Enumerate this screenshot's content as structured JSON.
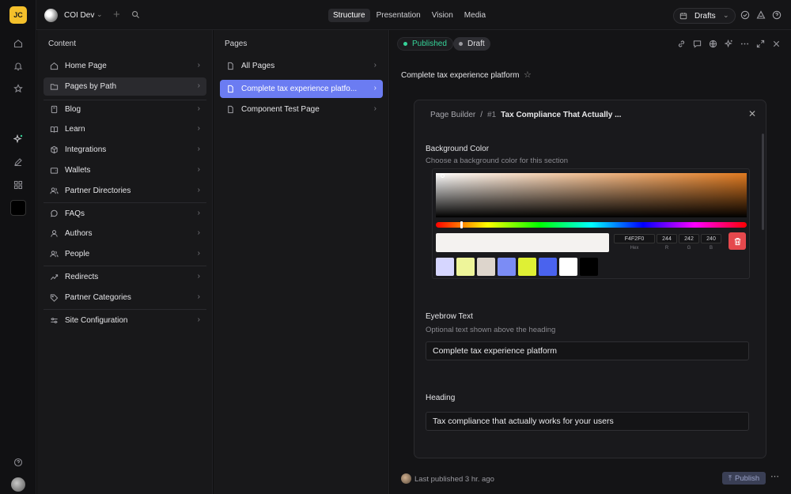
{
  "rail": {
    "avatar_initials": "JC",
    "icons": [
      "home-icon",
      "bell-icon",
      "star-icon",
      "sparkle-icon",
      "pen-icon",
      "grid-icon",
      "swatch-box",
      "help-icon",
      "user-avatar"
    ]
  },
  "topbar": {
    "workspace": "COI Dev",
    "tabs": [
      "Structure",
      "Presentation",
      "Vision",
      "Media"
    ],
    "active_tab": "Structure",
    "drafts_label": "Drafts"
  },
  "content_panel": {
    "title": "Content",
    "items": [
      {
        "label": "Home Page",
        "icon": "home-icon"
      },
      {
        "label": "Pages by Path",
        "icon": "folder-icon"
      },
      {
        "label": "Blog",
        "icon": "book-icon"
      },
      {
        "label": "Learn",
        "icon": "open-book-icon"
      },
      {
        "label": "Integrations",
        "icon": "cube-icon"
      },
      {
        "label": "Wallets",
        "icon": "wallet-icon"
      },
      {
        "label": "Partner Directories",
        "icon": "users-icon"
      },
      {
        "label": "FAQs",
        "icon": "chat-icon"
      },
      {
        "label": "Authors",
        "icon": "user-icon"
      },
      {
        "label": "People",
        "icon": "users-icon"
      },
      {
        "label": "Redirects",
        "icon": "share-icon"
      },
      {
        "label": "Partner Categories",
        "icon": "tag-icon"
      },
      {
        "label": "Site Configuration",
        "icon": "sliders-icon"
      }
    ]
  },
  "pages_panel": {
    "title": "Pages",
    "items": [
      {
        "label": "All Pages"
      },
      {
        "label": "Complete tax experience platfo..."
      },
      {
        "label": "Component Test Page"
      }
    ]
  },
  "editor": {
    "status_published": "Published",
    "status_draft": "Draft",
    "document_title": "Complete tax experience platform",
    "breadcrumb_root": "Page Builder",
    "breadcrumb_sep": "/",
    "breadcrumb_index": "#1",
    "breadcrumb_current": "Tax Compliance That Actually ...",
    "bg_color": {
      "label": "Background Color",
      "description": "Choose a background color for this section",
      "hex": "F4F2F0",
      "r": "244",
      "g": "242",
      "b": "240",
      "hex_label": "Hex",
      "r_label": "R",
      "g_label": "G",
      "b_label": "B",
      "swatches": [
        "#d6d6ff",
        "#eef59a",
        "#ddd5cc",
        "#7b8cf5",
        "#dff034",
        "#4a63ee",
        "#ffffff",
        "#000000"
      ]
    },
    "eyebrow": {
      "label": "Eyebrow Text",
      "description": "Optional text shown above the heading",
      "value": "Complete tax experience platform"
    },
    "heading": {
      "label": "Heading",
      "value": "Tax compliance that actually works for your users"
    },
    "footer_text": "Last published 3 hr. ago",
    "publish_label": "Publish"
  }
}
